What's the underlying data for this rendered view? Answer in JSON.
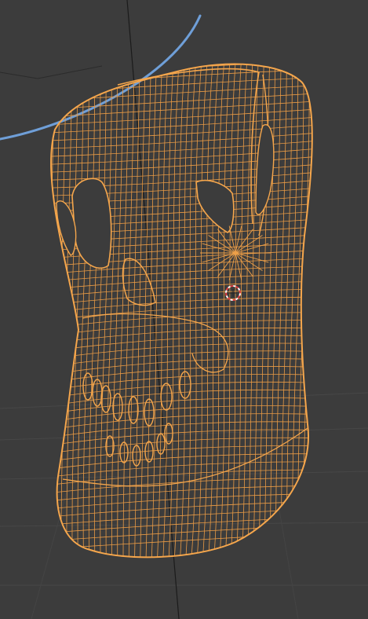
{
  "viewport": {
    "editor": "3D Viewport",
    "shading": "wireframe",
    "object_name": "",
    "selected": true
  },
  "colors": {
    "background": "#3c3c3c",
    "grid_line": "#4a4a4a",
    "axis_line": "#1a1a1a",
    "wire_selected": "#f2a14a",
    "wire_shadow": "#c27a2c",
    "curve": "#6f9fd8",
    "cursor_red": "#e04040",
    "cursor_white": "#ffffff"
  },
  "icons": {
    "cursor": "3d-cursor-icon"
  }
}
